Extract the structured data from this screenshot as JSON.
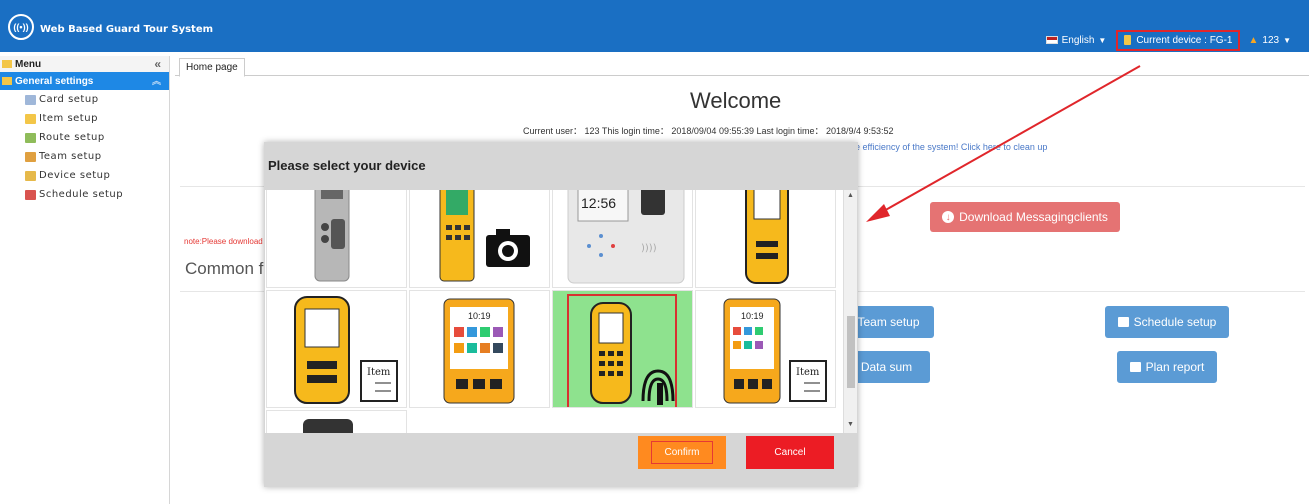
{
  "app": {
    "title": "Web Based Guard Tour System",
    "logo_glyph": "((•))"
  },
  "topbar": {
    "language": "English",
    "current_device": "Current device : FG-1",
    "user": "123"
  },
  "sidebar": {
    "menu_label": "Menu",
    "collapse_glyph": "«",
    "group_label": "General settings",
    "items": [
      {
        "label": "Card setup",
        "icon": "card-icon",
        "color": "#9fb7d9"
      },
      {
        "label": "Item setup",
        "icon": "item-icon",
        "color": "#f3c648"
      },
      {
        "label": "Route setup",
        "icon": "route-icon",
        "color": "#8fbc5a"
      },
      {
        "label": "Team setup",
        "icon": "team-icon",
        "color": "#e0a040"
      },
      {
        "label": "Device setup",
        "icon": "device-icon",
        "color": "#e6b94a"
      },
      {
        "label": "Schedule setup",
        "icon": "schedule-icon",
        "color": "#d9534f"
      }
    ]
  },
  "tabs": [
    {
      "label": "Home page"
    }
  ],
  "home": {
    "welcome": "Welcome",
    "login_info": "Current user：  123     This login time：  2018/09/04 09:55:39     Last login time：  2018/9/4 9:53:52",
    "clean_msg": "e efficiency of the system! Click here to clean up",
    "download_label": "Download Messagingclients",
    "note": "note:Please download",
    "common_label": "Common fu",
    "buttons": {
      "team_setup": "Team setup",
      "schedule_setup": "Schedule setup",
      "data_sum": "Data sum",
      "plan_report": "Plan report"
    }
  },
  "modal": {
    "title": "Please select your device",
    "confirm": "Confirm",
    "cancel": "Cancel",
    "clock_text": "12:56",
    "screen_time": "10:19",
    "item_label": "Item",
    "selected_index": 6
  },
  "colors": {
    "topbar": "#1a6fc3",
    "accent": "#1e88e5",
    "download": "#e57373",
    "function_button": "#5b9bd5",
    "confirm": "#ff8a1f",
    "cancel": "#ec1c24",
    "selected_cell": "#8ee28e",
    "annotation": "#e0262b"
  }
}
